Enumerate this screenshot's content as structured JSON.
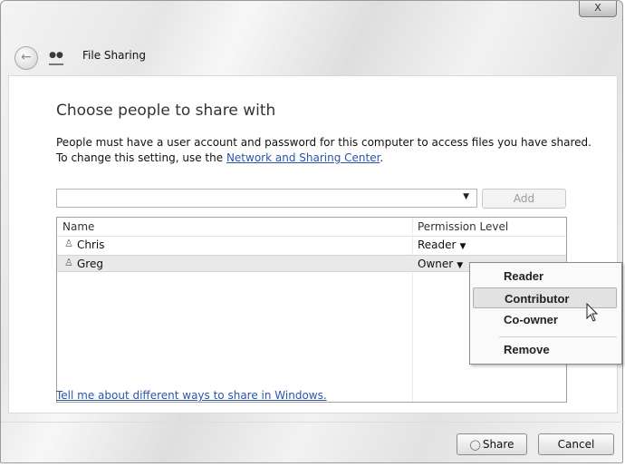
{
  "window": {
    "title": "File Sharing",
    "close_label": "X"
  },
  "content": {
    "heading": "Choose people to share with",
    "description_prefix": "People must have a user account and password for this computer to access files you have shared.  To change this setting, use the ",
    "description_link": "Network and Sharing Center",
    "description_suffix": "."
  },
  "picker": {
    "value": "",
    "add_label": "Add"
  },
  "list": {
    "columns": [
      "Name",
      "Permission Level"
    ],
    "rows": [
      {
        "name": "Chris",
        "permission": "Reader"
      },
      {
        "name": "Greg",
        "permission": "Owner"
      }
    ]
  },
  "menu": {
    "items": [
      "Reader",
      "Contributor",
      "Co-owner",
      "Remove"
    ],
    "hovered": "Contributor"
  },
  "help_link": "Tell me about different ways to share in Windows.",
  "footer": {
    "share_label": "Share",
    "cancel_label": "Cancel"
  }
}
